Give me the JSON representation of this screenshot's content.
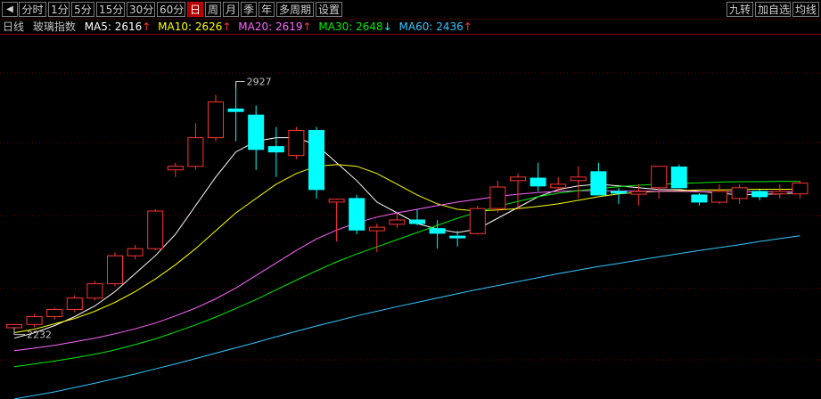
{
  "toolbar": {
    "back_icon": "left-arrow-icon",
    "periods": [
      "分时",
      "1分",
      "5分",
      "15分",
      "30分",
      "60分",
      "日",
      "周",
      "月",
      "季",
      "年",
      "多周期",
      "设置"
    ],
    "active_period": "日",
    "right_buttons": [
      "九转",
      "加自选",
      "均线"
    ]
  },
  "legend": {
    "period": "日线",
    "name": "玻璃指数",
    "ma5_label": "MA5: 2616",
    "ma10_label": "MA10: 2626",
    "ma20_label": "MA20: 2619",
    "ma30_label": "MA30: 2648",
    "ma60_label": "MA60: 2436",
    "ma5_arrow": "↑",
    "ma10_arrow": "↑",
    "ma20_arrow": "↑",
    "ma30_arrow": "↓",
    "ma60_arrow": "↑",
    "colors": {
      "ma5": "#ffffff",
      "ma10": "#ffff00",
      "ma20": "#ff66ff",
      "ma30": "#00ee00",
      "ma60": "#33c6ff",
      "up": "#ff3333",
      "down": "#00ffff"
    }
  },
  "chart_data": {
    "type": "candlestick",
    "annotations": {
      "high_label": "2927",
      "low_label": "2232"
    },
    "ylim": [
      2040,
      3060
    ],
    "candles": [
      {
        "o": 2239,
        "h": 2250,
        "l": 2225,
        "c": 2248
      },
      {
        "o": 2248,
        "h": 2278,
        "l": 2240,
        "c": 2270
      },
      {
        "o": 2270,
        "h": 2295,
        "l": 2262,
        "c": 2290
      },
      {
        "o": 2290,
        "h": 2330,
        "l": 2282,
        "c": 2322
      },
      {
        "o": 2322,
        "h": 2370,
        "l": 2315,
        "c": 2362
      },
      {
        "o": 2362,
        "h": 2450,
        "l": 2355,
        "c": 2440
      },
      {
        "o": 2440,
        "h": 2470,
        "l": 2430,
        "c": 2460
      },
      {
        "o": 2460,
        "h": 2570,
        "l": 2455,
        "c": 2565
      },
      {
        "o": 2680,
        "h": 2700,
        "l": 2660,
        "c": 2690
      },
      {
        "o": 2690,
        "h": 2810,
        "l": 2680,
        "c": 2770
      },
      {
        "o": 2770,
        "h": 2890,
        "l": 2760,
        "c": 2870
      },
      {
        "o": 2850,
        "h": 2927,
        "l": 2760,
        "c": 2843
      },
      {
        "o": 2833,
        "h": 2860,
        "l": 2680,
        "c": 2737
      },
      {
        "o": 2745,
        "h": 2800,
        "l": 2660,
        "c": 2730
      },
      {
        "o": 2720,
        "h": 2800,
        "l": 2710,
        "c": 2790
      },
      {
        "o": 2790,
        "h": 2800,
        "l": 2600,
        "c": 2625
      },
      {
        "o": 2590,
        "h": 2600,
        "l": 2480,
        "c": 2598
      },
      {
        "o": 2600,
        "h": 2610,
        "l": 2500,
        "c": 2512
      },
      {
        "o": 2510,
        "h": 2530,
        "l": 2450,
        "c": 2520
      },
      {
        "o": 2528,
        "h": 2560,
        "l": 2518,
        "c": 2540
      },
      {
        "o": 2540,
        "h": 2570,
        "l": 2525,
        "c": 2530
      },
      {
        "o": 2516,
        "h": 2540,
        "l": 2460,
        "c": 2503
      },
      {
        "o": 2495,
        "h": 2510,
        "l": 2466,
        "c": 2492
      },
      {
        "o": 2502,
        "h": 2580,
        "l": 2500,
        "c": 2572
      },
      {
        "o": 2572,
        "h": 2650,
        "l": 2560,
        "c": 2632
      },
      {
        "o": 2650,
        "h": 2670,
        "l": 2570,
        "c": 2660
      },
      {
        "o": 2657,
        "h": 2700,
        "l": 2620,
        "c": 2635
      },
      {
        "o": 2630,
        "h": 2660,
        "l": 2620,
        "c": 2640
      },
      {
        "o": 2650,
        "h": 2690,
        "l": 2600,
        "c": 2660
      },
      {
        "o": 2675,
        "h": 2700,
        "l": 2610,
        "c": 2610
      },
      {
        "o": 2620,
        "h": 2630,
        "l": 2585,
        "c": 2617
      },
      {
        "o": 2612,
        "h": 2640,
        "l": 2580,
        "c": 2620
      },
      {
        "o": 2630,
        "h": 2670,
        "l": 2600,
        "c": 2690
      },
      {
        "o": 2688,
        "h": 2695,
        "l": 2630,
        "c": 2630
      },
      {
        "o": 2610,
        "h": 2615,
        "l": 2580,
        "c": 2590
      },
      {
        "o": 2590,
        "h": 2640,
        "l": 2585,
        "c": 2620
      },
      {
        "o": 2600,
        "h": 2640,
        "l": 2585,
        "c": 2630
      },
      {
        "o": 2620,
        "h": 2625,
        "l": 2595,
        "c": 2605
      },
      {
        "o": 2613,
        "h": 2640,
        "l": 2600,
        "c": 2620
      },
      {
        "o": 2613,
        "h": 2650,
        "l": 2600,
        "c": 2643
      }
    ],
    "series": [
      {
        "key": "ma5",
        "values": [
          2210,
          2225,
          2245,
          2270,
          2300,
          2340,
          2390,
          2440,
          2500,
          2580,
          2660,
          2730,
          2760,
          2770,
          2770,
          2750,
          2700,
          2650,
          2590,
          2560,
          2530,
          2515,
          2505,
          2515,
          2545,
          2575,
          2605,
          2625,
          2635,
          2640,
          2635,
          2630,
          2625,
          2625,
          2620,
          2615,
          2610,
          2612,
          2613,
          2616
        ]
      },
      {
        "key": "ma10",
        "values": [
          2225,
          2235,
          2250,
          2265,
          2285,
          2310,
          2340,
          2375,
          2415,
          2460,
          2510,
          2560,
          2600,
          2640,
          2670,
          2690,
          2695,
          2690,
          2670,
          2640,
          2610,
          2585,
          2570,
          2565,
          2568,
          2572,
          2578,
          2585,
          2595,
          2605,
          2613,
          2618,
          2620,
          2622,
          2624,
          2624,
          2625,
          2626,
          2626,
          2626
        ]
      },
      {
        "key": "ma20",
        "values": [
          2175,
          2182,
          2190,
          2200,
          2210,
          2222,
          2236,
          2252,
          2272,
          2294,
          2320,
          2350,
          2385,
          2420,
          2455,
          2487,
          2512,
          2532,
          2548,
          2560,
          2570,
          2580,
          2590,
          2598,
          2606,
          2612,
          2617,
          2620,
          2622,
          2622,
          2621,
          2621,
          2620,
          2620,
          2619,
          2619,
          2619,
          2619,
          2619,
          2619
        ]
      },
      {
        "key": "ma30",
        "values": [
          2130,
          2138,
          2146,
          2155,
          2165,
          2177,
          2192,
          2208,
          2227,
          2247,
          2269,
          2293,
          2318,
          2345,
          2372,
          2398,
          2423,
          2445,
          2465,
          2485,
          2505,
          2525,
          2545,
          2562,
          2578,
          2592,
          2605,
          2615,
          2622,
          2628,
          2633,
          2637,
          2640,
          2642,
          2644,
          2646,
          2647,
          2647,
          2648,
          2648
        ]
      },
      {
        "key": "ma60",
        "values": [
          2040,
          2050,
          2060,
          2072,
          2084,
          2097,
          2110,
          2124,
          2138,
          2153,
          2168,
          2183,
          2198,
          2214,
          2229,
          2244,
          2258,
          2272,
          2285,
          2298,
          2310,
          2322,
          2334,
          2346,
          2357,
          2368,
          2379,
          2390,
          2400,
          2410,
          2419,
          2428,
          2437,
          2446,
          2455,
          2463,
          2471,
          2480,
          2488,
          2496
        ]
      }
    ]
  }
}
